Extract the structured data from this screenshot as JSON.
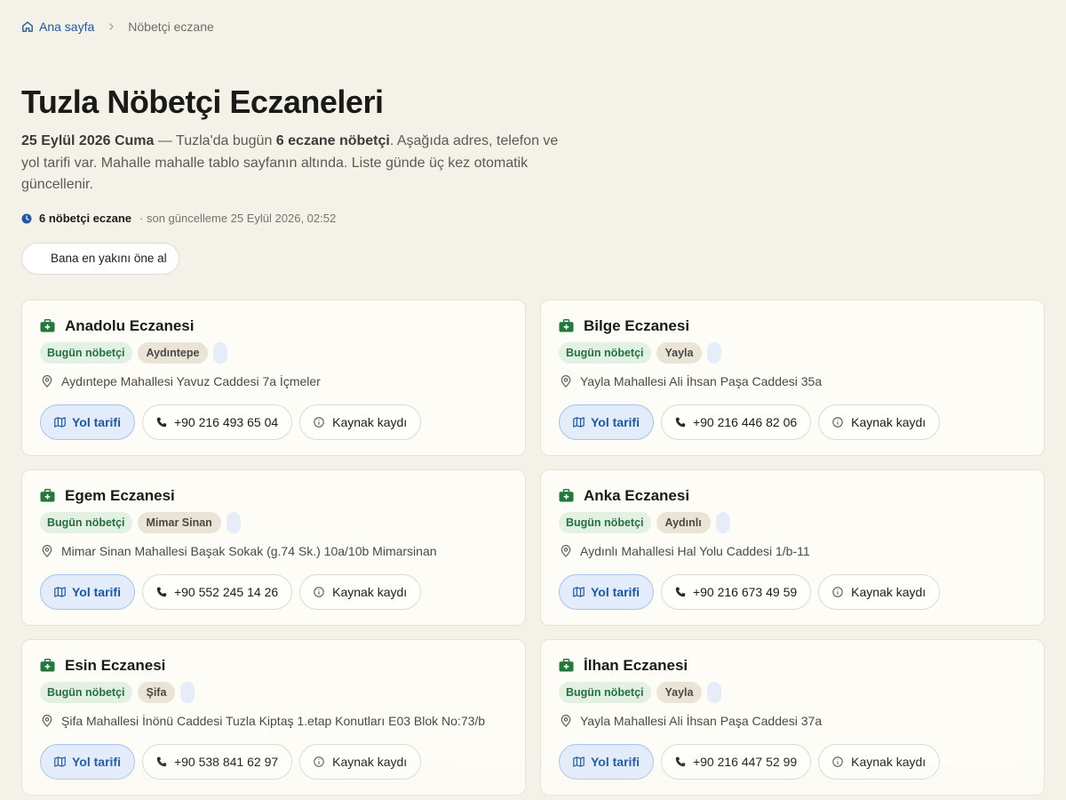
{
  "breadcrumb": {
    "home_label": "Ana sayfa",
    "current_label": "Nöbetçi eczane"
  },
  "header": {
    "title": "Tuzla Nöbetçi Eczaneleri",
    "intro_date": "25 Eylül 2026 Cuma",
    "intro_part1": " — Tuzla'da bugün ",
    "intro_count": "6 eczane nöbetçi",
    "intro_part2": ". Aşağıda adres, telefon ve yol tarifi var. Mahalle mahalle tablo sayfanın altında. Liste günde üç kez otomatik güncellenir."
  },
  "meta": {
    "count_label": "6 nöbetçi eczane",
    "updated_label": "· son güncelleme 25 Eylül 2026, 02:52"
  },
  "nearest_button_label": "Bana en yakını öne al",
  "labels": {
    "duty_badge": "Bugün nöbetçi",
    "route_button": "Yol tarifi",
    "source_button": "Kaynak kaydı"
  },
  "colors": {
    "accent_blue": "#1e56ad",
    "duty_green": "#247040",
    "kit_icon_green": "#1f7a3c",
    "background": "#f4f1e9"
  },
  "pharmacies": [
    {
      "name": "Anadolu Eczanesi",
      "neighborhood": "Aydıntepe",
      "address": "Aydıntepe Mahallesi Yavuz Caddesi 7a İçmeler",
      "phone": "+90 216 493 65 04"
    },
    {
      "name": "Bilge Eczanesi",
      "neighborhood": "Yayla",
      "address": "Yayla Mahallesi Ali İhsan Paşa Caddesi 35a",
      "phone": "+90 216 446 82 06"
    },
    {
      "name": "Egem Eczanesi",
      "neighborhood": "Mimar Sinan",
      "address": "Mimar Sinan Mahallesi Başak Sokak (g.74 Sk.) 10a/10b Mimarsinan",
      "phone": "+90 552 245 14 26"
    },
    {
      "name": "Anka Eczanesi",
      "neighborhood": "Aydınlı",
      "address": "Aydınlı Mahallesi Hal Yolu Caddesi 1/b-11",
      "phone": "+90 216 673 49 59"
    },
    {
      "name": "Esin Eczanesi",
      "neighborhood": "Şifa",
      "address": "Şifa Mahallesi İnönü Caddesi Tuzla Kiptaş 1.etap Konutları E03 Blok No:73/b",
      "phone": "+90 538 841 62 97"
    },
    {
      "name": "İlhan Eczanesi",
      "neighborhood": "Yayla",
      "address": "Yayla Mahallesi Ali İhsan Paşa Caddesi 37a",
      "phone": "+90 216 447 52 99"
    }
  ]
}
